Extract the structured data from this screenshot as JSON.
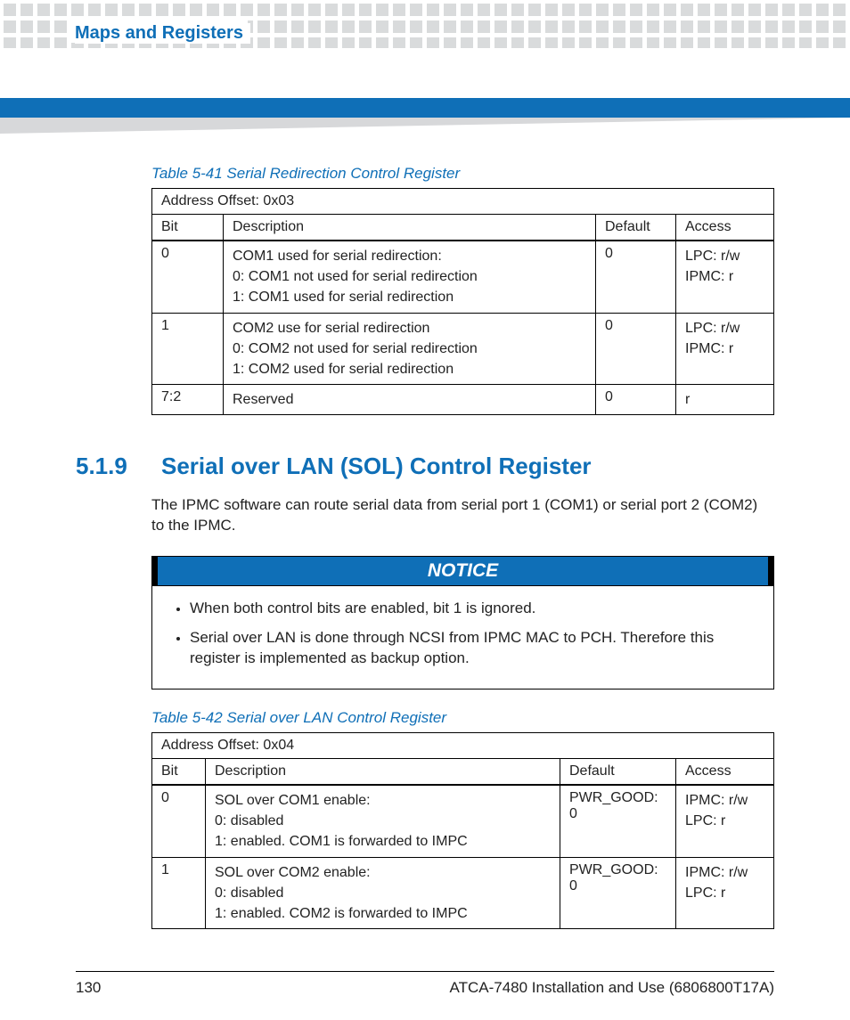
{
  "chapter": "Maps and Registers",
  "table1": {
    "caption": "Table 5-41 Serial Redirection Control Register",
    "offset": "Address Offset: 0x03",
    "headers": {
      "bit": "Bit",
      "desc": "Description",
      "def": "Default",
      "acc": "Access"
    },
    "rows": [
      {
        "bit": "0",
        "desc": [
          "COM1 used for serial redirection:",
          "0: COM1 not used for serial redirection",
          "1: COM1 used for serial redirection"
        ],
        "def": "0",
        "acc": [
          "LPC: r/w",
          "IPMC: r"
        ]
      },
      {
        "bit": "1",
        "desc": [
          "COM2 use for serial redirection",
          "0: COM2 not used for serial redirection",
          "1: COM2 used for serial redirection"
        ],
        "def": "0",
        "acc": [
          "LPC: r/w",
          "IPMC: r"
        ]
      },
      {
        "bit": "7:2",
        "desc": [
          "Reserved"
        ],
        "def": "0",
        "acc": [
          "r"
        ]
      }
    ]
  },
  "section": {
    "number": "5.1.9",
    "title": "Serial over LAN (SOL) Control Register",
    "body": "The IPMC software can route serial data from serial port 1 (COM1) or serial port 2 (COM2) to the IPMC."
  },
  "notice": {
    "label": "NOTICE",
    "items": [
      "When both control bits are enabled, bit 1 is ignored.",
      "Serial over LAN is done through NCSI from IPMC MAC to PCH. Therefore this register is implemented as backup option."
    ]
  },
  "table2": {
    "caption": "Table 5-42 Serial over LAN Control Register",
    "offset": "Address Offset: 0x04",
    "headers": {
      "bit": "Bit",
      "desc": "Description",
      "def": "Default",
      "acc": "Access"
    },
    "rows": [
      {
        "bit": "0",
        "desc": [
          "SOL over COM1 enable:",
          "0: disabled",
          "1: enabled. COM1 is forwarded to IMPC"
        ],
        "def": "PWR_GOOD: 0",
        "acc": [
          "IPMC: r/w",
          "LPC: r"
        ]
      },
      {
        "bit": "1",
        "desc": [
          "SOL over COM2 enable:",
          "0: disabled",
          "1: enabled. COM2 is forwarded to IMPC"
        ],
        "def": "PWR_GOOD: 0",
        "acc": [
          "IPMC: r/w",
          "LPC: r"
        ]
      }
    ]
  },
  "footer": {
    "page": "130",
    "doc": "ATCA-7480 Installation and Use (6806800T17A)"
  }
}
